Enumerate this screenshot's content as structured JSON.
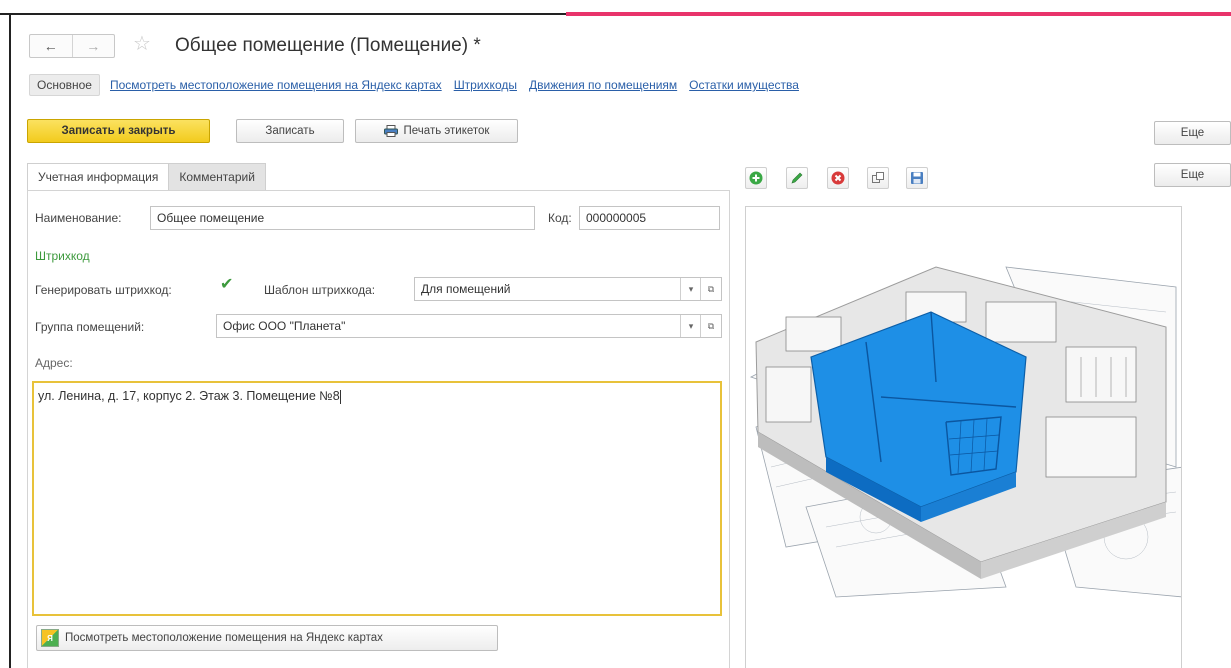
{
  "window": {
    "title": "Общее помещение (Помещение) *"
  },
  "nav": {
    "back": "←",
    "forward": "→"
  },
  "sections": {
    "main": "Основное",
    "links": [
      "Посмотреть местоположение помещения на Яндекс картах",
      "Штрихкоды",
      "Движения по помещениям",
      "Остатки имущества"
    ]
  },
  "toolbar": {
    "save_close": "Записать и закрыть",
    "save": "Записать",
    "print_labels": "Печать этикеток",
    "more": "Еще"
  },
  "form_tabs": [
    "Учетная информация",
    "Комментарий"
  ],
  "form": {
    "name_label": "Наименование:",
    "name_value": "Общее помещение",
    "code_label": "Код:",
    "code_value": "000000005",
    "barcode_group": "Штрихкод",
    "generate_label": "Генерировать штрихкод:",
    "generate_checked": true,
    "template_label": "Шаблон штрихкода:",
    "template_value": "Для помещений",
    "group_label": "Группа помещений:",
    "group_value": "Офис ООО \"Планета\"",
    "address_label": "Адрес:",
    "address_value": "ул. Ленина, д. 17, корпус 2. Этаж 3. Помещение №8",
    "map_button": "Посмотреть местоположение помещения на Яндекс картах"
  },
  "image_panel": {
    "more": "Еще",
    "tools": [
      "add-icon",
      "edit-icon",
      "delete-icon",
      "open-icon",
      "save-icon"
    ]
  },
  "colors": {
    "accent_button": "#f2cb1d",
    "link": "#2a5fa8",
    "group_title": "#3d9a3d",
    "address_border": "#e8c23a",
    "highlight_room": "#1e8fe6"
  }
}
